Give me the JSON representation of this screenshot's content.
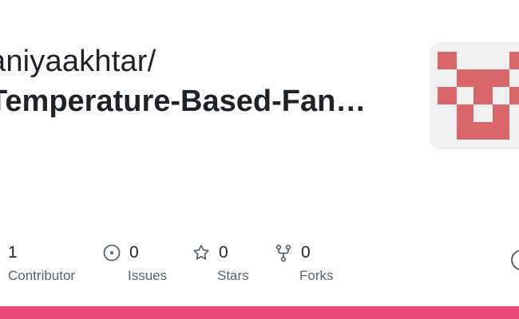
{
  "header": {
    "owner": "aniyaakhtar/",
    "repo": "Temperature-Based-Fan…"
  },
  "avatar": {
    "icon": "identicon",
    "color": "#d9676a"
  },
  "stats": [
    {
      "value": "1",
      "label": "Contributor",
      "icon": "contributors-icon"
    },
    {
      "value": "0",
      "label": "Issues",
      "icon": "issue-icon"
    },
    {
      "value": "0",
      "label": "Stars",
      "icon": "star-icon"
    },
    {
      "value": "0",
      "label": "Forks",
      "icon": "fork-icon"
    }
  ],
  "colors": {
    "accent_bar": "#e8477a",
    "text": "#1f2328",
    "muted": "#59636e"
  }
}
